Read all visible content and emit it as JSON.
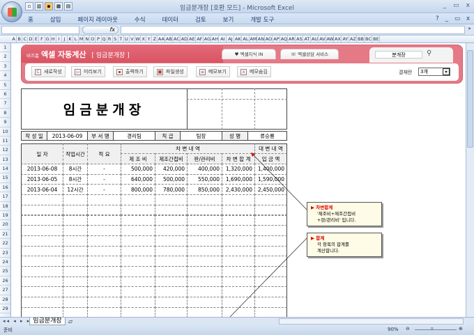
{
  "window": {
    "title": "임금분개장 [호환 모드] - Microsoft Excel",
    "controls": [
      "_",
      "▭",
      "x"
    ]
  },
  "ribbon": {
    "tabs": [
      "홈",
      "삽입",
      "페이지 레이아웃",
      "수식",
      "데이터",
      "검토",
      "보기",
      "개발 도구"
    ],
    "controls": [
      "?",
      "_",
      "▭",
      "x"
    ]
  },
  "formula_bar": {
    "name_box": "",
    "fx_label": "fx",
    "value": ""
  },
  "columns": [
    "A",
    "B",
    "C",
    "D",
    "E",
    "F",
    "G",
    "H",
    "I",
    "J",
    "K",
    "L",
    "M",
    "N",
    "O",
    "P",
    "Q",
    "R",
    "S",
    "T",
    "U",
    "V",
    "W",
    "X",
    "Y",
    "Z",
    "AA",
    "AB",
    "AC",
    "AD",
    "AE",
    "AF",
    "AG",
    "AH",
    "AI",
    "AJ",
    "AK",
    "AL",
    "AM",
    "AN",
    "AO",
    "AP",
    "AQ",
    "AR",
    "AS",
    "AT",
    "AU",
    "AV",
    "AW",
    "AX",
    "AY",
    "AZ",
    "BB",
    "BC",
    "BE"
  ],
  "banner": {
    "brand_small": "비즈폼",
    "brand": "엑셀 자동계산",
    "subtitle": "[ 임금분개장 ]",
    "tab1": "♥ 엑셀지식 IN",
    "tab2": "☏ 엑셀상담 서비스",
    "search_value": "분개장",
    "buttons": [
      "새로작성",
      "미리보기",
      "출력하기",
      "파일생성",
      "메모보기",
      "메모숨김"
    ],
    "approval_label": "결재란",
    "approval_value": "3개"
  },
  "document": {
    "title": "임금분개장",
    "info": {
      "date_label": "작 성 일",
      "date": "2013-06-09",
      "dept_label": "부 서 명",
      "dept": "경리팀",
      "rank_label": "직 급",
      "rank": "팀장",
      "name_label": "성 명",
      "name": "류승룡"
    },
    "headers": {
      "date": "일 자",
      "hours": "작업시간",
      "memo": "적 요",
      "debit": "차 변 내 역",
      "credit": "대 변 내 역",
      "mfg": "제 조 비",
      "overhead": "제조간접비",
      "admin": "판/관리비",
      "debit_total": "차 변 합 계",
      "deposit": "입 금 액"
    },
    "rows": [
      {
        "date": "2013-06-08",
        "hours": "8시간",
        "memo": "-",
        "mfg": "500,000",
        "overhead": "420,000",
        "admin": "400,000",
        "total": "1,320,000",
        "deposit": "1,400,000"
      },
      {
        "date": "2013-06-05",
        "hours": "8시간",
        "memo": "-",
        "mfg": "640,000",
        "overhead": "500,000",
        "admin": "550,000",
        "total": "1,690,000",
        "deposit": "1,590,000"
      },
      {
        "date": "2013-06-04",
        "hours": "12시간",
        "memo": "-",
        "mfg": "800,000",
        "overhead": "780,000",
        "admin": "850,000",
        "total": "2,430,000",
        "deposit": "2,450,000"
      }
    ]
  },
  "callouts": [
    {
      "title": "차변합계",
      "line1": "'제조비+제조간접비",
      "line2": "+판/관리비' 입니다."
    },
    {
      "title": "합계",
      "line1": "각 항목의 합계를",
      "line2": "계산합니다."
    }
  ],
  "sheet": {
    "nav": "◂◂ ◂ ▸ ▸▸",
    "tab": "임금분개장"
  },
  "status": {
    "ready": "준비",
    "zoom": "90%"
  }
}
